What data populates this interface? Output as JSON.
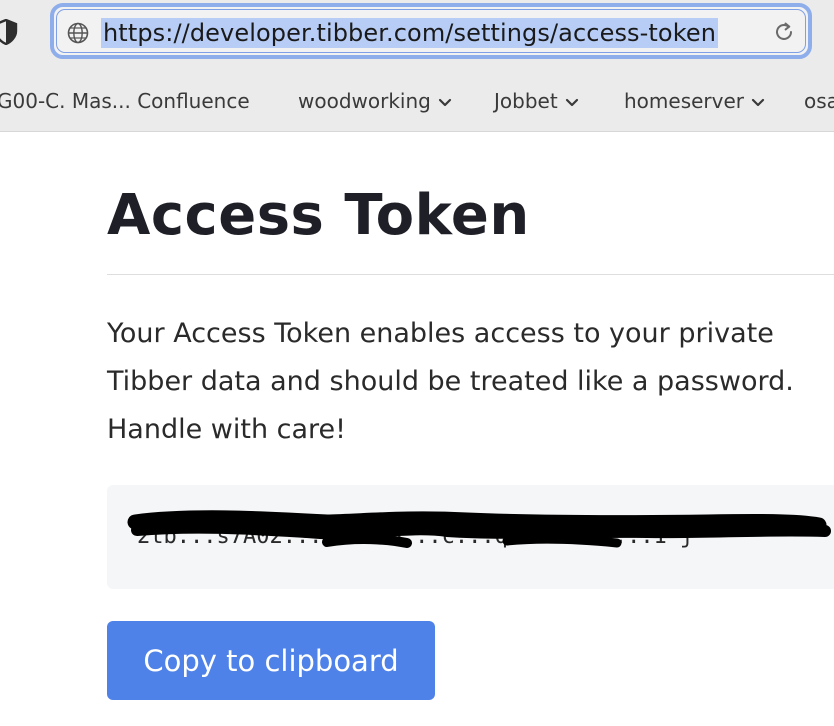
{
  "browser": {
    "url": "https://developer.tibber.com/settings/access-token",
    "icons": {
      "shield": "shield-icon",
      "site": "globe-icon",
      "reload": "reload-icon"
    },
    "bookmarks": [
      {
        "label": "G00-C. Mas... Confluence",
        "has_menu": false
      },
      {
        "label": "woodworking",
        "has_menu": true
      },
      {
        "label": "Jobbet",
        "has_menu": true
      },
      {
        "label": "homeserver",
        "has_menu": true
      },
      {
        "label": "osa",
        "has_menu": false
      }
    ]
  },
  "page": {
    "title": "Access Token",
    "description": "Your Access Token enables access to your private Tibber data and should be treated like a password. Handle with care!",
    "token_value": "2tb...s7A02...d...5D...c...q...eKb4N...1-j",
    "token_redacted": true,
    "copy_button_label": "Copy to clipboard"
  },
  "colors": {
    "accent": "#4f82e8",
    "url_highlight": "#b7cdf5",
    "url_focus_ring": "#8eadeb",
    "token_background": "#f5f6f8",
    "redaction": "#000000"
  }
}
